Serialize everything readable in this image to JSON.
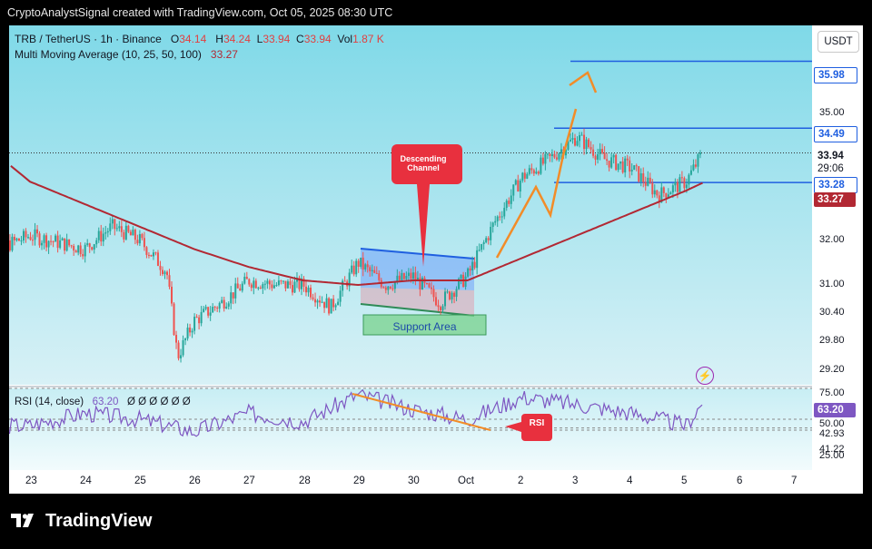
{
  "header": {
    "title": "CryptoAnalystSignal created with TradingView.com, Oct 05, 2025 08:30 UTC"
  },
  "legend": {
    "symbol": "TRB / TetherUS · 1h · Binance",
    "o_label": "O",
    "o": "34.14",
    "h_label": "H",
    "h": "34.24",
    "l_label": "L",
    "l": "33.94",
    "c_label": "C",
    "c": "33.94",
    "vol_label": "Vol",
    "vol": "1.87 K",
    "ma_label": "Multi Moving Average (10, 25, 50, 100)",
    "ma_value": "33.27"
  },
  "currency_button": "USDT",
  "annotations": {
    "descending_channel": [
      "Descending",
      "Channel"
    ],
    "support_area": "Support Area",
    "rsi_callout": "RSI"
  },
  "rsi_legend": {
    "label": "RSI (14, close)",
    "value": "63.20",
    "nulls": "Ø Ø Ø Ø Ø Ø"
  },
  "brand": "TradingView",
  "colors": {
    "chart_bg_top": "#7fd9e8",
    "chart_bg_bottom": "#d8f1f6",
    "up_candle": "#26a69a",
    "down_candle": "#ef5350",
    "ma_line": "#b22833",
    "resistance_lines": "#1f5fe0",
    "arrows": "#f28c28",
    "rsi_line": "#7e57c2",
    "callout": "#e8303e"
  },
  "chart_data": [
    {
      "type": "candlestick",
      "title": "TRB / TetherUS · 1h · Binance",
      "x_ticks": [
        "23",
        "24",
        "25",
        "26",
        "27",
        "28",
        "29",
        "30",
        "Oct",
        "2",
        "3",
        "4",
        "5",
        "6",
        "7"
      ],
      "y_ticks": [
        "35.00",
        "32.00",
        "31.00",
        "30.40",
        "29.80",
        "29.20"
      ],
      "price_labels": [
        {
          "value": "35.98",
          "style": "blue"
        },
        {
          "value": "34.49",
          "style": "blue"
        },
        {
          "value": "33.94",
          "style": "last"
        },
        {
          "value": "29:06",
          "style": "countdown"
        },
        {
          "value": "33.28",
          "style": "blue"
        },
        {
          "value": "33.27",
          "style": "ma"
        }
      ],
      "horizontal_levels": [
        35.98,
        34.49,
        33.28
      ],
      "ohlc_close_path": [
        [
          "Sep 22",
          31.6
        ],
        [
          "Sep 23",
          32.1
        ],
        [
          "Sep 24",
          31.8
        ],
        [
          "Sep 24.5",
          32.3
        ],
        [
          "Sep 25",
          32.0
        ],
        [
          "Sep 25.5",
          31.3
        ],
        [
          "Sep 25.7",
          29.4
        ],
        [
          "Sep 26",
          30.2
        ],
        [
          "Sep 26.5",
          30.6
        ],
        [
          "Sep 27",
          31.1
        ],
        [
          "Sep 27.5",
          31.0
        ],
        [
          "Sep 28",
          31.0
        ],
        [
          "Sep 28.5",
          30.5
        ],
        [
          "Sep 29",
          31.5
        ],
        [
          "Sep 29.5",
          31.0
        ],
        [
          "Sep 30",
          31.2
        ],
        [
          "Sep 30.5",
          30.6
        ],
        [
          "Oct 1",
          31.2
        ],
        [
          "Oct 1.5",
          32.4
        ],
        [
          "Oct 2",
          33.4
        ],
        [
          "Oct 2.5",
          33.8
        ],
        [
          "Oct 3",
          34.3
        ],
        [
          "Oct 3.5",
          33.8
        ],
        [
          "Oct 4",
          33.6
        ],
        [
          "Oct 4.5",
          33.0
        ],
        [
          "Oct 5",
          33.3
        ],
        [
          "Oct 5.3",
          33.94
        ]
      ],
      "moving_average_100": [
        [
          "Sep 22",
          34.3
        ],
        [
          "Sep 23",
          33.3
        ],
        [
          "Sep 24",
          32.8
        ],
        [
          "Sep 25",
          32.3
        ],
        [
          "Sep 26",
          31.8
        ],
        [
          "Sep 27",
          31.4
        ],
        [
          "Sep 28",
          31.1
        ],
        [
          "Sep 29",
          31.0
        ],
        [
          "Sep 30",
          31.1
        ],
        [
          "Oct 1",
          31.1
        ],
        [
          "Oct 2",
          31.6
        ],
        [
          "Oct 3",
          32.1
        ],
        [
          "Oct 4",
          32.6
        ],
        [
          "Oct 5",
          33.1
        ],
        [
          "Oct 5.3",
          33.27
        ]
      ]
    },
    {
      "type": "line",
      "title": "RSI (14, close)",
      "y_ticks": [
        "75.00",
        "50.00",
        "25.00"
      ],
      "levels": [
        75,
        50,
        42.93,
        41.22
      ],
      "labels": [
        "75.00",
        "63.20",
        "50.00",
        "42.93",
        "41.22"
      ],
      "current": 63.2,
      "x": [
        "Sep 23",
        "Sep 24",
        "Sep 25",
        "Sep 26",
        "Sep 27",
        "Sep 28",
        "Sep 29",
        "Sep 30",
        "Oct 1",
        "Oct 2",
        "Oct 3",
        "Oct 4",
        "Oct 5",
        "Oct 5.3"
      ],
      "values": [
        45,
        55,
        50,
        40,
        55,
        48,
        70,
        58,
        50,
        68,
        62,
        55,
        45,
        63.2
      ]
    }
  ]
}
